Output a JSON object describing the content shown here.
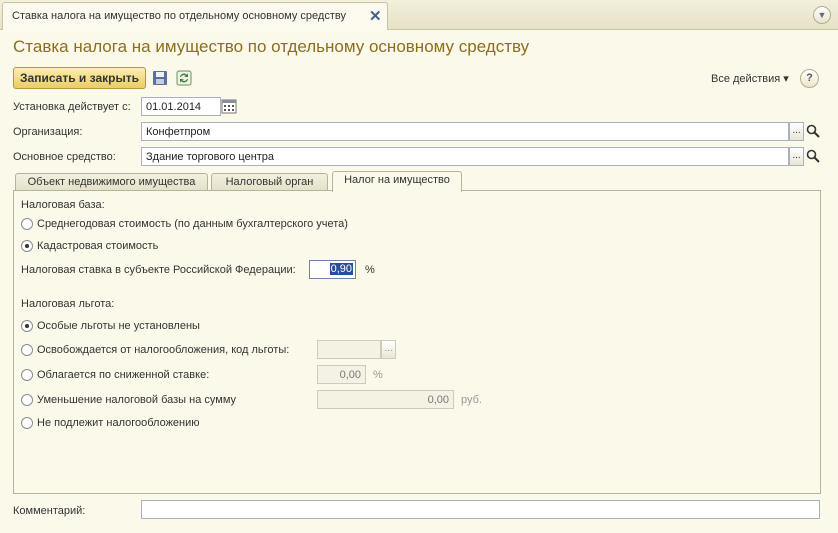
{
  "window": {
    "tab_title": "Ставка налога на имущество по отдельному основному средству",
    "close_symbol": "✕",
    "menu_symbol": "▼",
    "title": "Ставка налога на имущество по отдельному основному средству"
  },
  "toolbar": {
    "save_close_label": "Записать и закрыть",
    "save_icon": "floppy-disk-icon",
    "refresh_icon": "refresh-icon",
    "all_actions_label": "Все действия ▾",
    "help_label": "?"
  },
  "form": {
    "start_date_label": "Установка действует с:",
    "start_date_value": "01.01.2014",
    "organization_label": "Организация:",
    "organization_value": "Конфетпром",
    "asset_label": "Основное средство:",
    "asset_value": "Здание торгового центра",
    "select_symbol": "...",
    "search_icon": "magnifier-icon",
    "calendar_icon": "calendar-icon"
  },
  "tabs": [
    {
      "label": "Объект недвижимого имущества"
    },
    {
      "label": "Налоговый орган"
    },
    {
      "label": "Налог на имущество"
    }
  ],
  "tax_base": {
    "heading": "Налоговая база:",
    "options": [
      {
        "label": "Среднегодовая стоимость (по данным бухгалтерского учета)",
        "selected": false
      },
      {
        "label": "Кадастровая стоимость",
        "selected": true
      }
    ],
    "rate_label": "Налоговая ставка в субъекте Российской Федерации:",
    "rate_value": "0,90",
    "rate_unit": "%"
  },
  "benefit": {
    "heading": "Налоговая льгота:",
    "options": [
      {
        "label": "Особые льготы не установлены",
        "selected": true
      },
      {
        "label": "Освобождается от налогообложения, код льготы:",
        "selected": false
      },
      {
        "label": "Облагается по сниженной ставке:",
        "selected": false
      },
      {
        "label": "Уменьшение налоговой базы на сумму",
        "selected": false
      },
      {
        "label": "Не подлежит налогообложению",
        "selected": false
      }
    ],
    "code_value": "",
    "reduced_rate_value": "0,00",
    "reduced_rate_unit": "%",
    "reduction_amount_value": "0,00",
    "reduction_amount_unit": "руб."
  },
  "comment": {
    "label": "Комментарий:",
    "value": ""
  }
}
